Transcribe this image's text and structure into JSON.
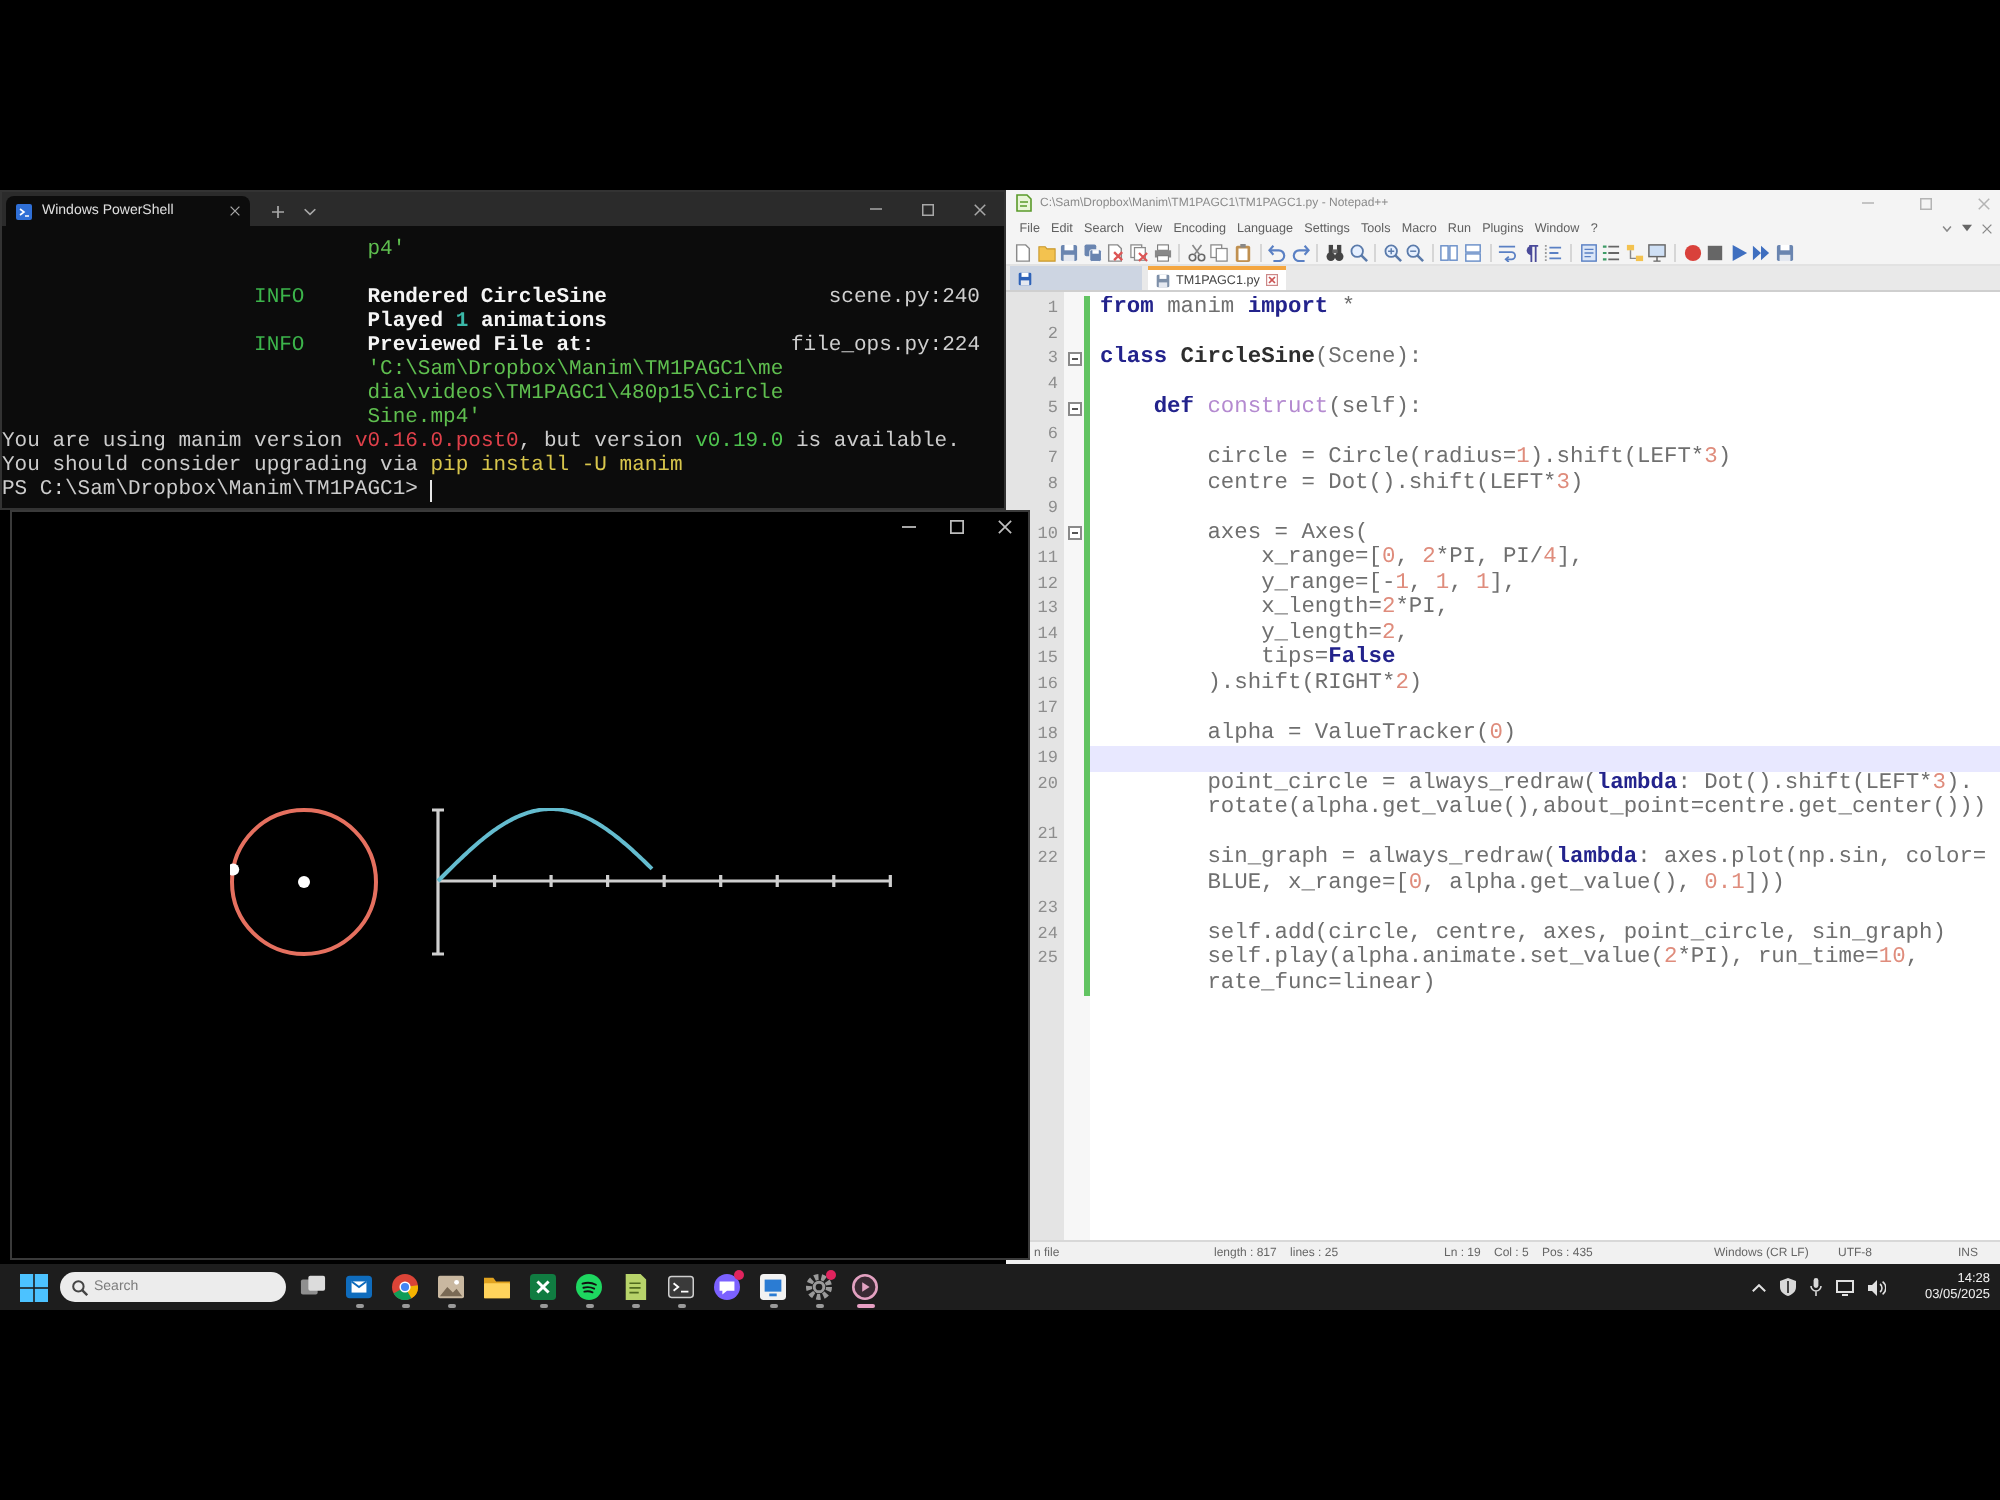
{
  "terminal_window": {
    "tab_title": "Windows PowerShell",
    "lines": [
      {
        "kind": "continuation",
        "message": [
          {
            "kind": "path",
            "text": "p4'"
          }
        ]
      },
      {
        "kind": "blank"
      },
      {
        "kind": "log",
        "tag": "INFO",
        "message": [
          {
            "kind": "strong",
            "text": "Rendered CircleSine"
          }
        ],
        "source": "scene.py:240"
      },
      {
        "kind": "continuation",
        "message": [
          {
            "kind": "strong",
            "text": "Played "
          },
          {
            "kind": "number",
            "text": "1"
          },
          {
            "kind": "strong",
            "text": " animations"
          }
        ]
      },
      {
        "kind": "log",
        "tag": "INFO",
        "message": [
          {
            "kind": "strong",
            "text": "Previewed File at:"
          }
        ],
        "source": "file_ops.py:224"
      },
      {
        "kind": "continuation",
        "message": [
          {
            "kind": "path",
            "text": "'C:\\Sam\\Dropbox\\Manim\\TM1PAGC1\\me"
          }
        ]
      },
      {
        "kind": "continuation",
        "message": [
          {
            "kind": "path",
            "text": "dia\\videos\\TM1PAGC1\\480p15\\Circle"
          }
        ]
      },
      {
        "kind": "continuation",
        "message": [
          {
            "kind": "path",
            "text": "Sine.mp4'"
          }
        ]
      },
      {
        "kind": "plain",
        "message": [
          {
            "kind": "text",
            "text": "You are using manim version "
          },
          {
            "kind": "old",
            "text": "v0.16.0.post0"
          },
          {
            "kind": "text",
            "text": ", but version "
          },
          {
            "kind": "new",
            "text": "v0.19.0"
          },
          {
            "kind": "text",
            "text": " is available."
          }
        ]
      },
      {
        "kind": "plain",
        "message": [
          {
            "kind": "text",
            "text": "You should consider upgrading via "
          },
          {
            "kind": "command",
            "text": "pip install -U manim"
          }
        ]
      },
      {
        "kind": "prompt",
        "message": [
          {
            "kind": "text",
            "text": "PS C:\\Sam\\Dropbox\\Manim\\TM1PAGC1>"
          }
        ]
      }
    ]
  },
  "editor_window": {
    "title": "C:\\Sam\\Dropbox\\Manim\\TM1PAGC1\\TM1PAGC1.py - Notepad++",
    "menu": [
      "File",
      "Edit",
      "Search",
      "View",
      "Encoding",
      "Language",
      "Settings",
      "Tools",
      "Macro",
      "Run",
      "Plugins",
      "Window",
      "?"
    ],
    "tabs": [
      {
        "selected": false
      },
      {
        "label": "TM1PAGC1.py",
        "selected": true
      }
    ],
    "lines": [
      {
        "number": "1",
        "current": false,
        "code": [
          {
            "kind": "keyword",
            "text": "from"
          },
          {
            "kind": "text",
            "text": " manim "
          },
          {
            "kind": "keyword",
            "text": "import"
          },
          {
            "kind": "text",
            "text": " *"
          }
        ]
      },
      {
        "number": "2",
        "current": false
      },
      {
        "number": "3",
        "current": false,
        "code": [
          {
            "kind": "keyword",
            "text": "class "
          },
          {
            "kind": "class_name",
            "text": "CircleSine"
          },
          {
            "kind": "text",
            "text": "(Scene):"
          }
        ],
        "children": [
          {
            "number": "4",
            "current": false
          },
          {
            "number": "5",
            "current": false,
            "code": [
              {
                "kind": "keyword",
                "text": "def "
              },
              {
                "kind": "function_name",
                "text": "construct"
              },
              {
                "kind": "text",
                "text": "(self):"
              }
            ],
            "children": [
              {
                "number": "6",
                "current": false
              },
              {
                "number": "7",
                "current": false,
                "code": [
                  {
                    "kind": "text",
                    "text": "circle = Circle(radius="
                  },
                  {
                    "kind": "number",
                    "text": "1"
                  },
                  {
                    "kind": "text",
                    "text": ").shift(LEFT*"
                  },
                  {
                    "kind": "number",
                    "text": "3"
                  },
                  {
                    "kind": "text",
                    "text": ")"
                  }
                ]
              },
              {
                "number": "8",
                "current": false,
                "code": [
                  {
                    "kind": "text",
                    "text": "centre = Dot().shift(LEFT*"
                  },
                  {
                    "kind": "number",
                    "text": "3"
                  },
                  {
                    "kind": "text",
                    "text": ")"
                  }
                ]
              },
              {
                "number": "9",
                "current": false
              },
              {
                "number": "10",
                "current": false,
                "code": [
                  {
                    "kind": "text",
                    "text": "axes = Axes("
                  }
                ],
                "children": [
                  {
                    "number": "11",
                    "current": false,
                    "code": [
                      {
                        "kind": "text",
                        "text": "x_range=["
                      },
                      {
                        "kind": "number",
                        "text": "0"
                      },
                      {
                        "kind": "text",
                        "text": ", "
                      },
                      {
                        "kind": "number",
                        "text": "2"
                      },
                      {
                        "kind": "text",
                        "text": "*PI, PI/"
                      },
                      {
                        "kind": "number",
                        "text": "4"
                      },
                      {
                        "kind": "text",
                        "text": "],"
                      }
                    ]
                  },
                  {
                    "number": "12",
                    "current": false,
                    "code": [
                      {
                        "kind": "text",
                        "text": "y_range=[-"
                      },
                      {
                        "kind": "number",
                        "text": "1"
                      },
                      {
                        "kind": "text",
                        "text": ", "
                      },
                      {
                        "kind": "number",
                        "text": "1"
                      },
                      {
                        "kind": "text",
                        "text": ", "
                      },
                      {
                        "kind": "number",
                        "text": "1"
                      },
                      {
                        "kind": "text",
                        "text": "],"
                      }
                    ]
                  },
                  {
                    "number": "13",
                    "current": false,
                    "code": [
                      {
                        "kind": "text",
                        "text": "x_length="
                      },
                      {
                        "kind": "number",
                        "text": "2"
                      },
                      {
                        "kind": "text",
                        "text": "*PI,"
                      }
                    ]
                  },
                  {
                    "number": "14",
                    "current": false,
                    "code": [
                      {
                        "kind": "text",
                        "text": "y_length="
                      },
                      {
                        "kind": "number",
                        "text": "2"
                      },
                      {
                        "kind": "text",
                        "text": ","
                      }
                    ]
                  },
                  {
                    "number": "15",
                    "current": false,
                    "code": [
                      {
                        "kind": "text",
                        "text": "tips="
                      },
                      {
                        "kind": "keyword",
                        "text": "False"
                      }
                    ]
                  }
                ]
              },
              {
                "number": "16",
                "current": false,
                "code": [
                  {
                    "kind": "text",
                    "text": ").shift(RIGHT*"
                  },
                  {
                    "kind": "number",
                    "text": "2"
                  },
                  {
                    "kind": "text",
                    "text": ")"
                  }
                ]
              },
              {
                "number": "17",
                "current": false
              },
              {
                "number": "18",
                "current": false,
                "code": [
                  {
                    "kind": "text",
                    "text": "alpha = ValueTracker("
                  },
                  {
                    "kind": "number",
                    "text": "0"
                  },
                  {
                    "kind": "text",
                    "text": ")"
                  }
                ]
              },
              {
                "number": "19",
                "current": true
              },
              {
                "number": "20",
                "current": false,
                "code": [
                  {
                    "kind": "text",
                    "text": "point_circle = always_redraw("
                  },
                  {
                    "kind": "keyword",
                    "text": "lambda"
                  },
                  {
                    "kind": "text",
                    "text": ": Dot().shift(LEFT*"
                  },
                  {
                    "kind": "number",
                    "text": "3"
                  },
                  {
                    "kind": "text",
                    "text": ")."
                  }
                ],
                "wrapped": [
                  {
                    "kind": "text",
                    "text": "rotate(alpha.get_value(),about_point=centre.get_center()))"
                  }
                ]
              },
              {
                "number": "21",
                "current": false
              },
              {
                "number": "22",
                "current": false,
                "code": [
                  {
                    "kind": "text",
                    "text": "sin_graph = always_redraw("
                  },
                  {
                    "kind": "keyword",
                    "text": "lambda"
                  },
                  {
                    "kind": "text",
                    "text": ": axes.plot(np.sin, color="
                  }
                ],
                "wrapped": [
                  {
                    "kind": "text",
                    "text": "BLUE, x_range=["
                  },
                  {
                    "kind": "number",
                    "text": "0"
                  },
                  {
                    "kind": "text",
                    "text": ", alpha.get_value(), "
                  },
                  {
                    "kind": "number",
                    "text": "0.1"
                  },
                  {
                    "kind": "text",
                    "text": "]))"
                  }
                ]
              },
              {
                "number": "23",
                "current": false
              },
              {
                "number": "24",
                "current": false,
                "code": [
                  {
                    "kind": "text",
                    "text": "self.add(circle, centre, axes, point_circle, sin_graph)"
                  }
                ]
              },
              {
                "number": "25",
                "current": false,
                "code": [
                  {
                    "kind": "text",
                    "text": "self.play(alpha.animate.set_value("
                  },
                  {
                    "kind": "number",
                    "text": "2"
                  },
                  {
                    "kind": "text",
                    "text": "*PI), run_time="
                  },
                  {
                    "kind": "number",
                    "text": "10"
                  },
                  {
                    "kind": "text",
                    "text": ","
                  }
                ],
                "wrapped": [
                  {
                    "kind": "text",
                    "text": "rate_func=linear)"
                  }
                ]
              }
            ]
          }
        ]
      }
    ],
    "status_bar": [
      "n file",
      "length : 817    lines : 25",
      "Ln : 19    Col : 5    Pos : 435",
      "Windows (CR LF)",
      "UTF-8",
      "INS"
    ]
  },
  "taskbar": {
    "search": {
      "placeholder": "Search"
    },
    "apps": [
      {
        "running": false,
        "badge": false,
        "selected": false
      },
      {
        "running": true,
        "badge": false,
        "selected": false
      },
      {
        "running": true,
        "badge": false,
        "selected": false
      },
      {
        "running": true,
        "badge": false,
        "selected": false
      },
      {
        "running": false,
        "badge": false,
        "selected": false
      },
      {
        "running": true,
        "badge": false,
        "selected": false
      },
      {
        "running": true,
        "badge": false,
        "selected": false
      },
      {
        "running": true,
        "badge": false,
        "selected": false
      },
      {
        "running": true,
        "badge": false,
        "selected": false
      },
      {
        "running": false,
        "badge": true,
        "selected": false
      },
      {
        "running": true,
        "badge": false,
        "selected": false
      },
      {
        "running": true,
        "badge": true,
        "selected": false
      },
      {
        "running": true,
        "badge": false,
        "selected": true
      }
    ],
    "clock": {
      "time": "14:28",
      "date": "03/05/2025"
    }
  }
}
